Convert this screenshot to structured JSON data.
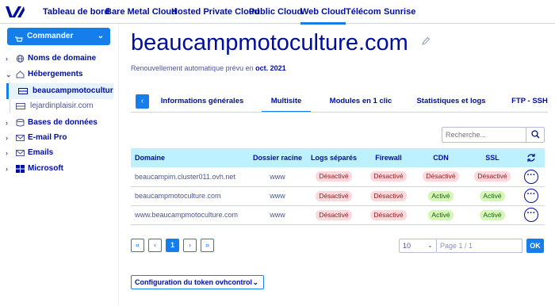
{
  "topnav": {
    "items": [
      "Tableau de bord",
      "Bare Metal Cloud",
      "Hosted Private Cloud",
      "Public Cloud",
      "Web Cloud",
      "Télécom",
      "Sunrise"
    ],
    "active_index": 4
  },
  "sidebar": {
    "order_button": "Commander",
    "items": [
      {
        "label": "Noms de domaine",
        "icon": "globe-icon",
        "expanded": false
      },
      {
        "label": "Hébergements",
        "icon": "hosting-icon",
        "expanded": true
      },
      {
        "label": "Bases de données",
        "icon": "database-icon",
        "expanded": false
      },
      {
        "label": "E-mail Pro",
        "icon": "mail-icon",
        "expanded": false
      },
      {
        "label": "Emails",
        "icon": "mail-icon",
        "expanded": false
      },
      {
        "label": "Microsoft",
        "icon": "microsoft-icon",
        "expanded": false
      }
    ],
    "sub_items": [
      {
        "label": "beaucampmotocultur...",
        "selected": true
      },
      {
        "label": "lejardinplaisir.com",
        "selected": false
      }
    ]
  },
  "page": {
    "title": "beaucampmotoculture.com",
    "renewal_text": "Renouvellement automatique prévu en",
    "renewal_date": "oct. 2021"
  },
  "tabs": [
    "Informations générales",
    "Multisite",
    "Modules en 1 clic",
    "Statistiques et logs",
    "FTP - SSH"
  ],
  "active_tab": 1,
  "search": {
    "placeholder": "Recherche..."
  },
  "table": {
    "headers": [
      "Domaine",
      "Dossier racine",
      "Logs séparés",
      "Firewall",
      "CDN",
      "SSL"
    ],
    "rows": [
      {
        "domain": "beaucampim.cluster011.ovh.net",
        "root": "www",
        "logs": "Désactivé",
        "firewall": "Désactivé",
        "cdn": "Désactivé",
        "ssl": "Désactivé"
      },
      {
        "domain": "beaucampmotoculture.com",
        "root": "www",
        "logs": "Désactivé",
        "firewall": "Désactivé",
        "cdn": "Activé",
        "ssl": "Activé"
      },
      {
        "domain": "www.beaucampmotoculture.com",
        "root": "www",
        "logs": "Désactivé",
        "firewall": "Désactivé",
        "cdn": "Activé",
        "ssl": "Activé"
      }
    ],
    "more_label": "···"
  },
  "pagination": {
    "first": "«",
    "prev": "‹",
    "current": "1",
    "next": "›",
    "last": "»",
    "page_size": "10",
    "page_text": "Page 1 / 1",
    "ok_label": "OK"
  },
  "token_button": "Configuration du token ovhcontrol"
}
